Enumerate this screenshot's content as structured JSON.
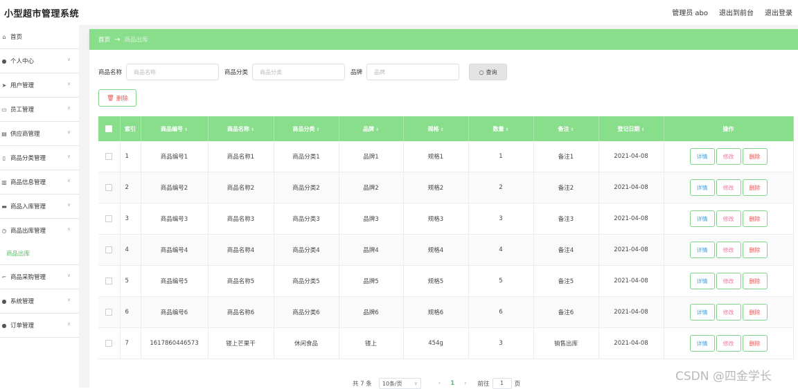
{
  "app": {
    "title": "小型超市管理系统"
  },
  "topbar": {
    "user": "管理员 abo",
    "front": "退出到前台",
    "logout": "退出登录"
  },
  "sidebar": {
    "items": [
      {
        "label": "首页",
        "icon": "home-icon"
      },
      {
        "label": "个人中心",
        "icon": "user-icon"
      },
      {
        "label": "用户管理",
        "icon": "send-icon"
      },
      {
        "label": "员工管理",
        "icon": "ticket-icon"
      },
      {
        "label": "供应商管理",
        "icon": "suitcase-icon"
      },
      {
        "label": "商品分类管理",
        "icon": "document-icon"
      },
      {
        "label": "商品信息管理",
        "icon": "chart-icon"
      },
      {
        "label": "商品入库管理",
        "icon": "monitor-icon"
      },
      {
        "label": "商品出库管理",
        "icon": "clock-icon"
      },
      {
        "label": "商品采购管理",
        "icon": "crop-icon"
      },
      {
        "label": "系统管理",
        "icon": "location-icon"
      },
      {
        "label": "订单管理",
        "icon": "user-icon"
      }
    ],
    "sub_active": "商品出库"
  },
  "breadcrumb": {
    "home": "首页",
    "current": "商品出库"
  },
  "search": {
    "name_label": "商品名称",
    "name_placeholder": "商品名称",
    "category_label": "商品分类",
    "category_placeholder": "商品分类",
    "brand_label": "品牌",
    "brand_placeholder": "品牌",
    "button": "查询"
  },
  "delete_button": "删除",
  "table": {
    "headers": [
      "索引",
      "商品编号",
      "商品名称",
      "商品分类",
      "品牌",
      "规格",
      "数量",
      "备注",
      "登记日期",
      "操作"
    ],
    "rows": [
      [
        "1",
        "商品编号1",
        "商品名称1",
        "商品分类1",
        "品牌1",
        "规格1",
        "1",
        "备注1",
        "2021-04-08"
      ],
      [
        "2",
        "商品编号2",
        "商品名称2",
        "商品分类2",
        "品牌2",
        "规格2",
        "2",
        "备注2",
        "2021-04-08"
      ],
      [
        "3",
        "商品编号3",
        "商品名称3",
        "商品分类3",
        "品牌3",
        "规格3",
        "3",
        "备注3",
        "2021-04-08"
      ],
      [
        "4",
        "商品编号4",
        "商品名称4",
        "商品分类4",
        "品牌4",
        "规格4",
        "4",
        "备注4",
        "2021-04-08"
      ],
      [
        "5",
        "商品编号5",
        "商品名称5",
        "商品分类5",
        "品牌5",
        "规格5",
        "5",
        "备注5",
        "2021-04-08"
      ],
      [
        "6",
        "商品编号6",
        "商品名称6",
        "商品分类6",
        "品牌6",
        "规格6",
        "6",
        "备注6",
        "2021-04-08"
      ],
      [
        "7",
        "1617860446573",
        "镂上芒果干",
        "休闲食品",
        "镂上",
        "454g",
        "3",
        "销售出库",
        "2021-04-08"
      ]
    ],
    "actions": {
      "detail": "详情",
      "edit": "修改",
      "remove": "删除"
    }
  },
  "pagination": {
    "total": "共 7 条",
    "page_size": "10条/页",
    "current": "1",
    "goto_label": "前往",
    "goto_value": "1",
    "page_suffix": "页"
  },
  "watermark": "CSDN @四金学长",
  "colors": {
    "accent": "#89de8c",
    "danger": "#e25a5a",
    "info": "#4a9fd9",
    "edit": "#e77ea3"
  }
}
